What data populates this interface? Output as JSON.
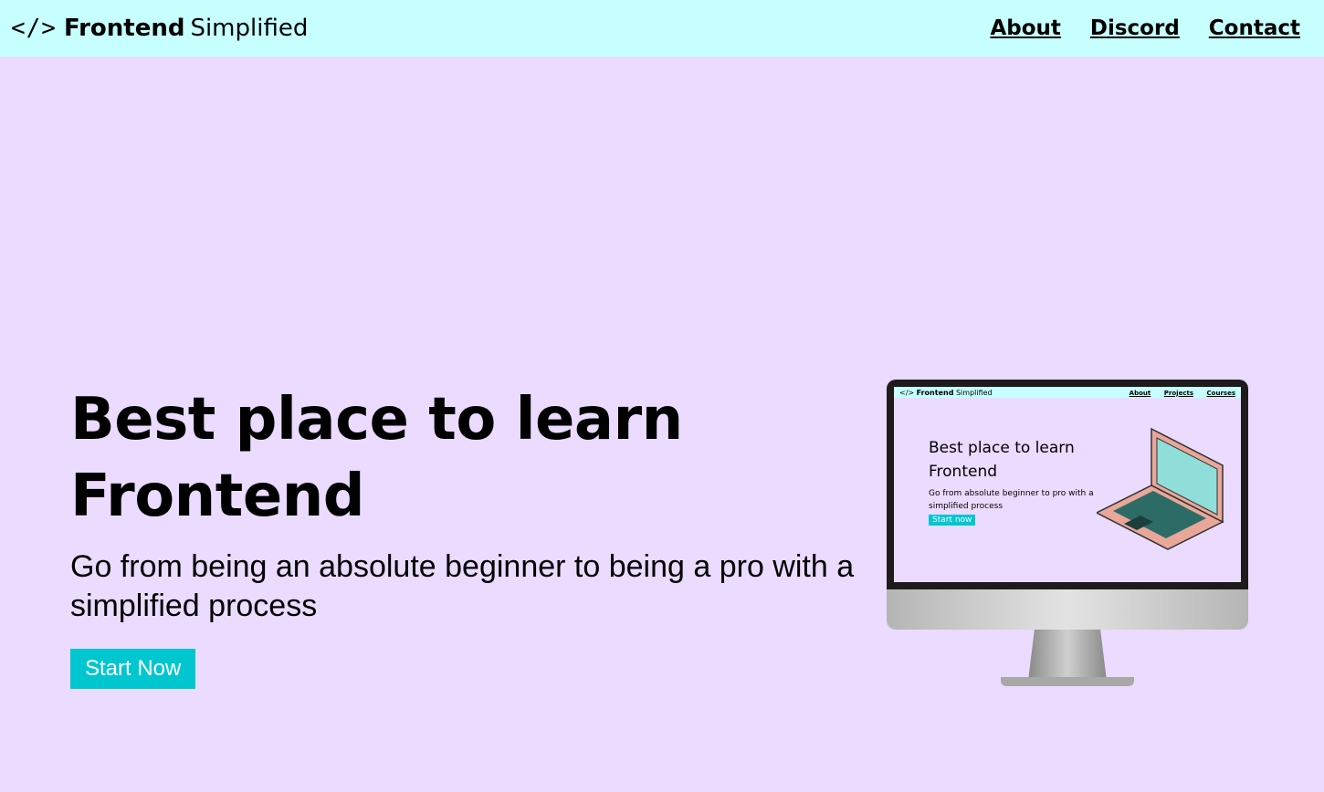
{
  "nav": {
    "logo_icon": "</>",
    "logo_bold": "Frontend",
    "logo_light": "Simplified",
    "links": [
      {
        "label": "About"
      },
      {
        "label": "Discord"
      },
      {
        "label": "Contact"
      }
    ]
  },
  "hero": {
    "title": "Best place to learn Frontend",
    "subtitle": "Go from being an absolute beginner to being a pro with a simplified process",
    "cta": "Start Now"
  },
  "illustration": {
    "mini_logo_icon": "</>",
    "mini_logo_bold": "Frontend",
    "mini_logo_light": "Simplified",
    "mini_links": [
      "About",
      "Projects",
      "Courses"
    ],
    "mini_title": "Best place to learn Frontend",
    "mini_subtitle": "Go from absolute beginner to pro with a simplified process",
    "mini_cta": "Start now"
  },
  "colors": {
    "page_bg": "#ebdbff",
    "nav_bg": "#c6fffe",
    "accent": "#00c6d0"
  }
}
